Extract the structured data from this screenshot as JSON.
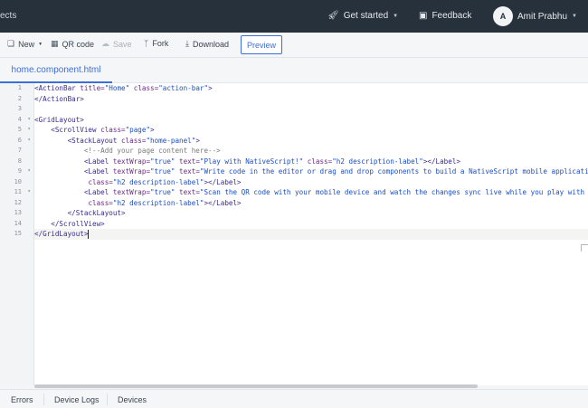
{
  "topbar": {
    "brand_fragment": "ects",
    "get_started": "Get started",
    "feedback": "Feedback",
    "avatar_initial": "A",
    "user_name": "Amit Prabhu"
  },
  "toolbar": {
    "new_label": "New",
    "qr_label": "QR code",
    "save_label": "Save",
    "fork_label": "Fork",
    "download_label": "Download",
    "preview_label": "Preview"
  },
  "editor": {
    "file_tab": "home.component.html",
    "lines": [
      {
        "n": "1",
        "fold": false
      },
      {
        "n": "2",
        "fold": false
      },
      {
        "n": "3",
        "fold": false
      },
      {
        "n": "4",
        "fold": true
      },
      {
        "n": "5",
        "fold": true
      },
      {
        "n": "6",
        "fold": true
      },
      {
        "n": "7",
        "fold": false
      },
      {
        "n": "8",
        "fold": false
      },
      {
        "n": "9",
        "fold": true
      },
      {
        "n": "10",
        "fold": false
      },
      {
        "n": "11",
        "fold": true
      },
      {
        "n": "12",
        "fold": false
      },
      {
        "n": "13",
        "fold": false
      },
      {
        "n": "14",
        "fold": false
      },
      {
        "n": "15",
        "fold": false
      }
    ],
    "code": {
      "l1": {
        "open": "<ActionBar ",
        "a1": "title=",
        "v1": "\"Home\"",
        "a2": " class=",
        "v2": "\"action-bar\"",
        "close": ">"
      },
      "l2": "</ActionBar>",
      "l4": "<GridLayout>",
      "l5": {
        "open": "    <ScrollView ",
        "a1": "class=",
        "v1": "\"page\"",
        "close": ">"
      },
      "l6": {
        "open": "        <StackLayout ",
        "a1": "class=",
        "v1": "\"home-panel\"",
        "close": ">"
      },
      "l7": "            <!--Add your page content here-->",
      "l8": {
        "open": "            <Label ",
        "a1": "textWrap=",
        "v1": "\"true\"",
        "a2": " text=",
        "v2": "\"Play with NativeScript!\"",
        "a3": " class=",
        "v3": "\"h2 description-label\"",
        "close": "></Label>"
      },
      "l9": {
        "open": "            <Label ",
        "a1": "textWrap=",
        "v1": "\"true\"",
        "a2": " text=",
        "v2": "\"Write code in the editor or drag and drop components to build a NativeScript mobile application.\""
      },
      "l10": {
        "indent": "             ",
        "a1": "class=",
        "v1": "\"h2 description-label\"",
        "close": "></Label>"
      },
      "l11": {
        "open": "            <Label ",
        "a1": "textWrap=",
        "v1": "\"true\"",
        "a2": " text=",
        "v2": "\"Scan the QR code with your mobile device and watch the changes sync live while you play with the code.\""
      },
      "l12": {
        "indent": "             ",
        "a1": "class=",
        "v1": "\"h2 description-label\"",
        "close": "></Label>"
      },
      "l13": "        </StackLayout>",
      "l14": "    </ScrollView>",
      "l15": "</GridLayout>"
    }
  },
  "bottom_tabs": {
    "errors": "Errors",
    "device_logs": "Device Logs",
    "devices": "Devices"
  },
  "colors": {
    "topbar_bg": "#27313b",
    "accent": "#3d6fd8"
  }
}
